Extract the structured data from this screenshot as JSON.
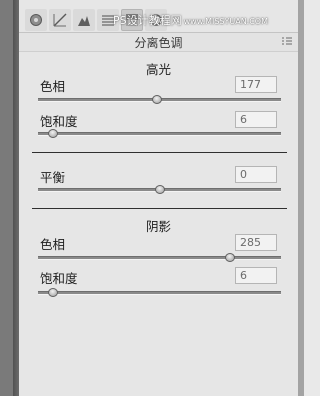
{
  "toolbar": {
    "icons": [
      "tone-curve-icon",
      "histogram-icon",
      "mountain-icon",
      "lines-icon",
      "split-toning-icon",
      "lens-icon"
    ]
  },
  "watermark": {
    "text": "PS设计教程网",
    "site": "www.MISSYUAN.COM"
  },
  "panel": {
    "title": "分离色调"
  },
  "highlights": {
    "title": "高光",
    "hue_label": "色相",
    "hue_value": "177",
    "hue_level": 0.49,
    "sat_label": "饱和度",
    "sat_value": "6",
    "sat_level": 0.06
  },
  "balance": {
    "label": "平衡",
    "value": "0",
    "level": 0.5
  },
  "shadows": {
    "title": "阴影",
    "hue_label": "色相",
    "hue_value": "285",
    "hue_level": 0.79,
    "sat_label": "饱和度",
    "sat_value": "6",
    "sat_level": 0.06
  }
}
